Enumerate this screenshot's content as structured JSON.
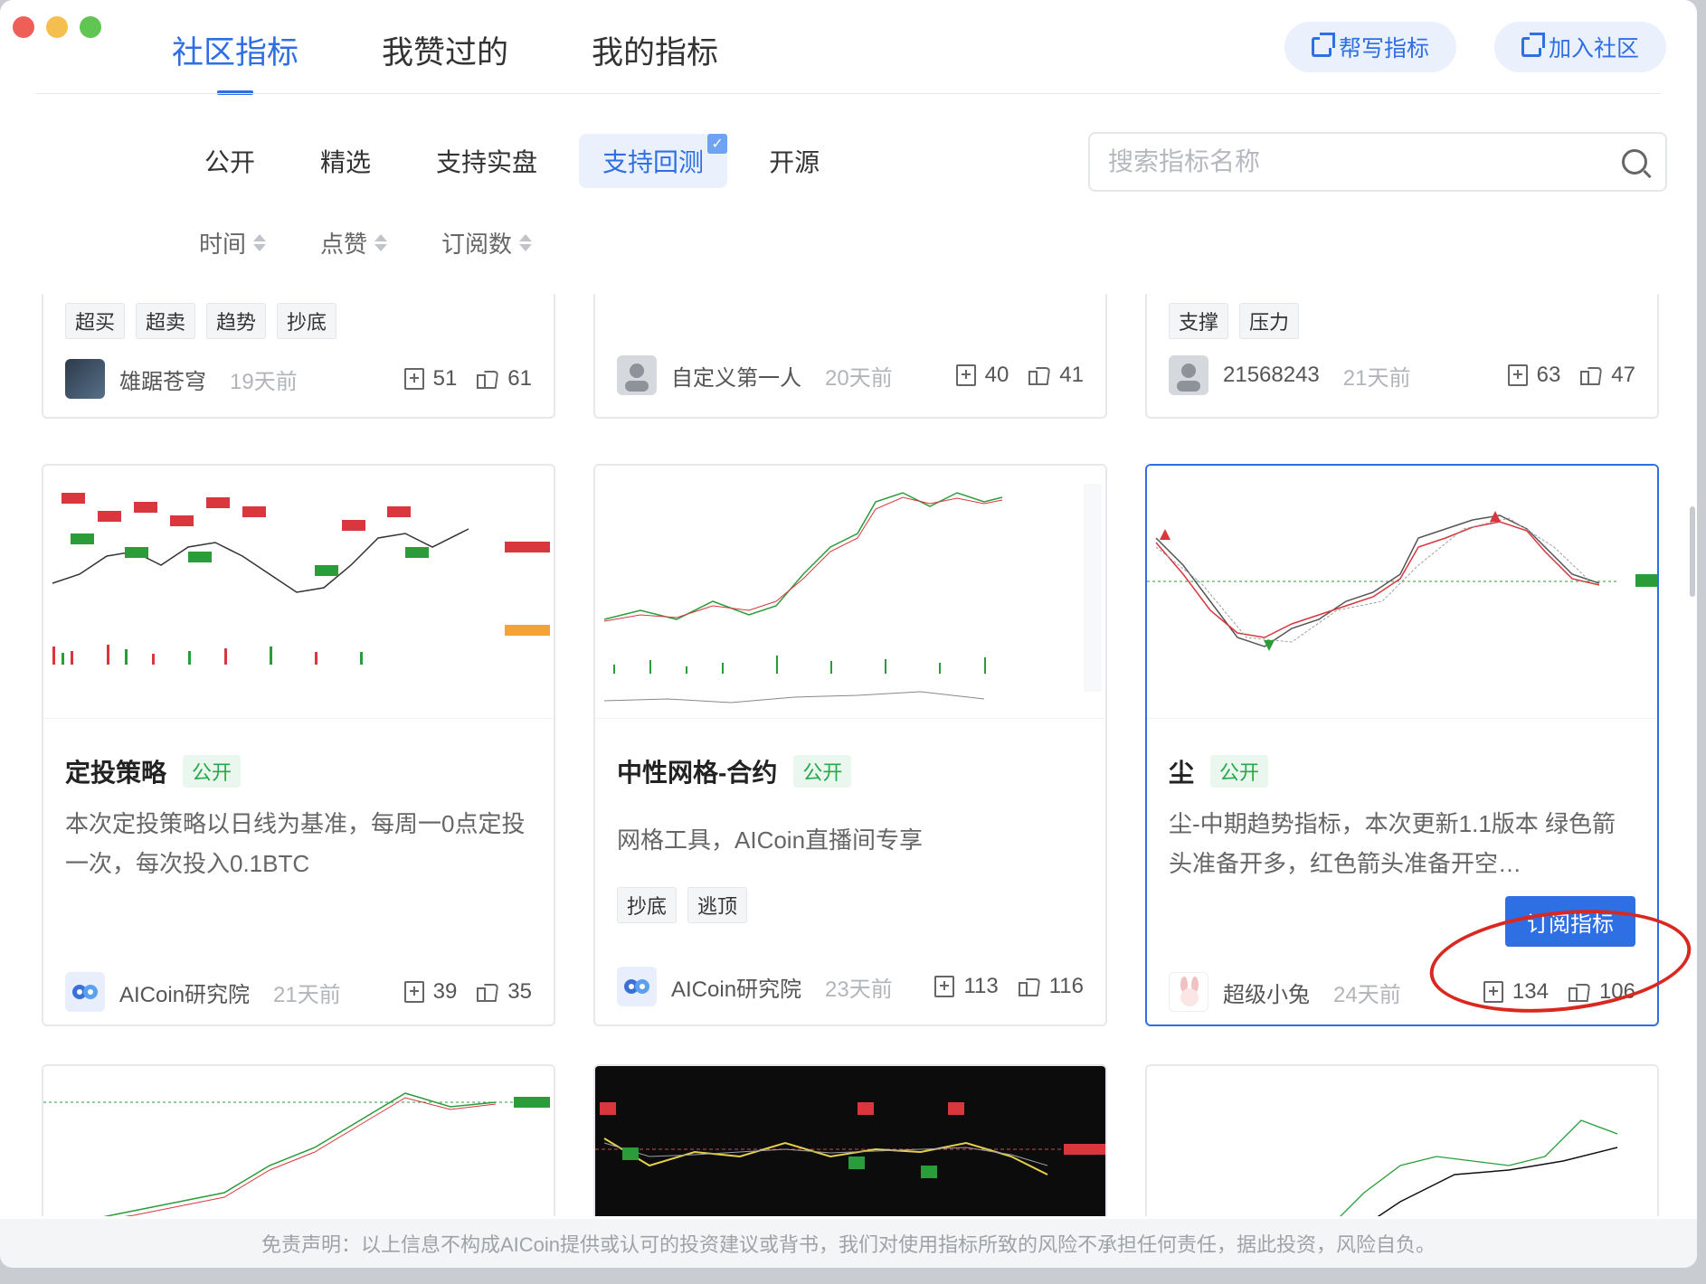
{
  "top_tabs": [
    "社区指标",
    "我赞过的",
    "我的指标"
  ],
  "top_buttons": {
    "help": "帮写指标",
    "join": "加入社区"
  },
  "filters": [
    "公开",
    "精选",
    "支持实盘",
    "支持回测",
    "开源"
  ],
  "search": {
    "placeholder": "搜索指标名称"
  },
  "sorts": [
    "时间",
    "点赞",
    "订阅数"
  ],
  "row1": [
    {
      "tags": [
        "超买",
        "超卖",
        "趋势",
        "抄底"
      ],
      "author": "雄踞苍穹",
      "time": "19天前",
      "subs": "51",
      "likes": "61"
    },
    {
      "tags": [],
      "author": "自定义第一人",
      "time": "20天前",
      "subs": "40",
      "likes": "41"
    },
    {
      "tags": [
        "支撑",
        "压力"
      ],
      "author": "21568243",
      "time": "21天前",
      "subs": "63",
      "likes": "47"
    }
  ],
  "row2": [
    {
      "title": "定投策略",
      "badge": "公开",
      "desc": "本次定投策略以日线为基准，每周一0点定投一次，每次投入0.1BTC",
      "tags": [],
      "author": "AICoin研究院",
      "time": "21天前",
      "subs": "39",
      "likes": "35"
    },
    {
      "title": "中性网格-合约",
      "badge": "公开",
      "desc": "网格工具，AICoin直播间专享",
      "tags": [
        "抄底",
        "逃顶"
      ],
      "author": "AICoin研究院",
      "time": "23天前",
      "subs": "113",
      "likes": "116"
    },
    {
      "title": "尘",
      "badge": "公开",
      "desc": "尘-中期趋势指标，本次更新1.1版本 绿色箭头准备开多，红色箭头准备开空…",
      "tags": [],
      "author": "超级小兔",
      "time": "24天前",
      "subs": "134",
      "likes": "106",
      "subscribe_label": "订阅指标"
    }
  ],
  "disclaimer": "免责声明：以上信息不构成AICoin提供或认可的投资建议或背书，我们对使用指标所致的风险不承担任何责任，据此投资，风险自负。",
  "colors": {
    "accent": "#2f6fe4",
    "public_green": "#27a84a",
    "annotation_red": "#d8281f"
  }
}
